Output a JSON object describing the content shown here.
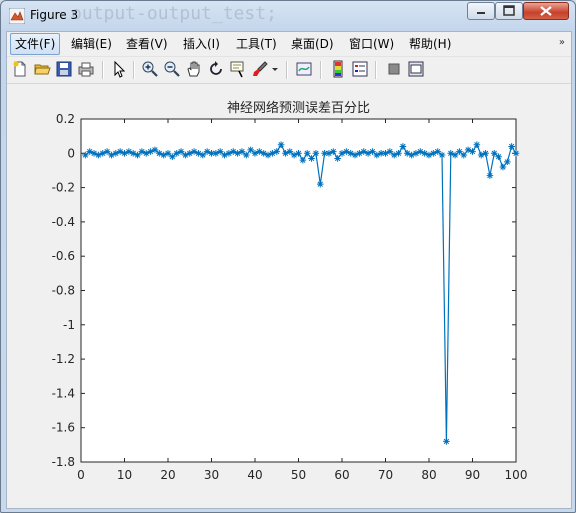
{
  "window": {
    "title": "Figure 3",
    "background_text": "output-output_test;",
    "controls": [
      "minimize",
      "maximize",
      "close"
    ]
  },
  "menu": {
    "items": [
      {
        "label": "文件(F)",
        "active": true
      },
      {
        "label": "编辑(E)"
      },
      {
        "label": "查看(V)"
      },
      {
        "label": "插入(I)"
      },
      {
        "label": "工具(T)"
      },
      {
        "label": "桌面(D)"
      },
      {
        "label": "窗口(W)"
      },
      {
        "label": "帮助(H)"
      }
    ],
    "overflow_icon": "chevron-double-icon"
  },
  "toolbar": {
    "icons": [
      "new-figure-icon",
      "open-file-icon",
      "save-icon",
      "print-icon",
      "select-arrow-icon",
      "zoom-in-icon",
      "zoom-out-icon",
      "pan-hand-icon",
      "rotate-3d-icon",
      "data-cursor-icon",
      "brush-icon",
      "brush-dropdown-icon",
      "link-plot-icon",
      "insert-colorbar-icon",
      "insert-legend-icon",
      "hide-plot-tools-icon",
      "show-plot-tools-icon"
    ]
  },
  "colors": {
    "line": "#0072bd",
    "axes_bg": "#ffffff",
    "figure_bg": "#f0f0f0"
  },
  "chart_data": {
    "type": "line",
    "marker": "*",
    "title": "神经网络预测误差百分比",
    "xlabel": "",
    "ylabel": "",
    "xlim": [
      0,
      100
    ],
    "ylim": [
      -1.8,
      0.2
    ],
    "xticks": [
      0,
      10,
      20,
      30,
      40,
      50,
      60,
      70,
      80,
      90,
      100
    ],
    "yticks": [
      0.2,
      0,
      -0.2,
      -0.4,
      -0.6,
      -0.8,
      -1,
      -1.2,
      -1.4,
      -1.6,
      -1.8
    ],
    "xtick_labels": [
      "0",
      "10",
      "20",
      "30",
      "40",
      "50",
      "60",
      "70",
      "80",
      "90",
      "100"
    ],
    "ytick_labels": [
      "0.2",
      "0",
      "-0.2",
      "-0.4",
      "-0.6",
      "-0.8",
      "-1",
      "-1.2",
      "-1.4",
      "-1.6",
      "-1.8"
    ],
    "grid": false,
    "series": [
      {
        "x": [
          1,
          2,
          3,
          4,
          5,
          6,
          7,
          8,
          9,
          10,
          11,
          12,
          13,
          14,
          15,
          16,
          17,
          18,
          19,
          20,
          21,
          22,
          23,
          24,
          25,
          26,
          27,
          28,
          29,
          30,
          31,
          32,
          33,
          34,
          35,
          36,
          37,
          38,
          39,
          40,
          41,
          42,
          43,
          44,
          45,
          46,
          47,
          48,
          49,
          50,
          51,
          52,
          53,
          54,
          55,
          56,
          57,
          58,
          59,
          60,
          61,
          62,
          63,
          64,
          65,
          66,
          67,
          68,
          69,
          70,
          71,
          72,
          73,
          74,
          75,
          76,
          77,
          78,
          79,
          80,
          81,
          82,
          83,
          84,
          85,
          86,
          87,
          88,
          89,
          90,
          91,
          92,
          93,
          94,
          95,
          96,
          97,
          98,
          99,
          100
        ],
        "values": [
          -0.01,
          0.01,
          0.0,
          -0.01,
          0.0,
          0.01,
          -0.01,
          0.0,
          0.01,
          0.0,
          0.01,
          0.0,
          -0.01,
          0.01,
          0.0,
          0.01,
          0.02,
          0.0,
          -0.01,
          0.0,
          -0.02,
          0.0,
          0.01,
          -0.01,
          0.0,
          0.01,
          0.0,
          -0.01,
          0.01,
          0.0,
          0.0,
          0.01,
          -0.01,
          0.0,
          0.01,
          0.0,
          0.01,
          -0.01,
          0.02,
          0.0,
          0.01,
          0.0,
          -0.01,
          0.0,
          0.01,
          0.05,
          0.0,
          0.01,
          -0.01,
          0.0,
          -0.04,
          0.0,
          -0.03,
          0.0,
          -0.18,
          0.0,
          0.0,
          0.01,
          -0.03,
          0.0,
          0.01,
          0.0,
          -0.01,
          0.0,
          0.01,
          0.0,
          0.01,
          -0.01,
          0.0,
          0.0,
          0.01,
          -0.01,
          0.0,
          0.04,
          0.0,
          -0.01,
          0.0,
          0.01,
          0.0,
          -0.01,
          0.0,
          0.01,
          -0.01,
          -1.68,
          0.0,
          -0.01,
          0.01,
          -0.01,
          0.02,
          0.01,
          0.05,
          -0.01,
          0.0,
          -0.13,
          0.0,
          -0.02,
          -0.08,
          -0.05,
          0.04,
          0.0
        ]
      }
    ]
  }
}
